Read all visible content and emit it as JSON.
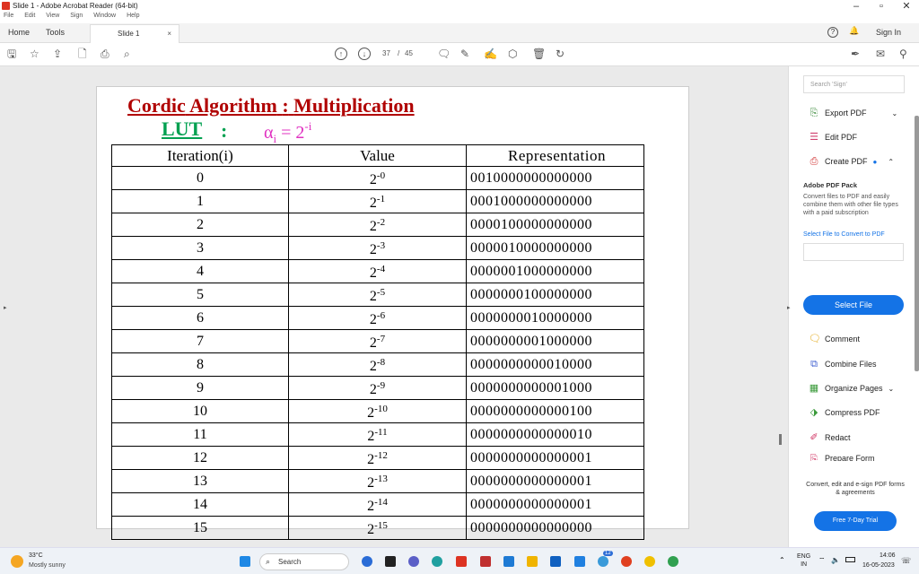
{
  "window": {
    "title": "Slide 1 - Adobe Acrobat Reader (64-bit)",
    "controls": [
      "–",
      "▫",
      "✕"
    ]
  },
  "menu": [
    "File",
    "Edit",
    "View",
    "Sign",
    "Window",
    "Help"
  ],
  "tabs": {
    "home": "Home",
    "tools": "Tools",
    "doc": "Slide 1",
    "close": "×",
    "sign_in": "Sign In"
  },
  "toolbar": {
    "page_current": "37",
    "page_sep": "/",
    "page_total": "45"
  },
  "slide": {
    "title_word1": "Cordic",
    "title_word2": "Algorithm",
    "title_colon": ":",
    "title_word3": "Multiplication",
    "lut": "LUT",
    "lut_colon": ":",
    "alpha": "α",
    "alpha_sub": "i",
    "equals": "= 2",
    "exp": "-i",
    "headers": [
      "Iteration(i)",
      "Value",
      "Representation"
    ],
    "rows": [
      {
        "i": "0",
        "base": "2",
        "exp": "-0",
        "rep": "0010000000000000"
      },
      {
        "i": "1",
        "base": "2",
        "exp": "-1",
        "rep": "0001000000000000"
      },
      {
        "i": "2",
        "base": "2",
        "exp": "-2",
        "rep": "0000100000000000"
      },
      {
        "i": "3",
        "base": "2",
        "exp": "-3",
        "rep": "0000010000000000"
      },
      {
        "i": "4",
        "base": "2",
        "exp": "-4",
        "rep": "0000001000000000"
      },
      {
        "i": "5",
        "base": "2",
        "exp": "-5",
        "rep": "0000000100000000"
      },
      {
        "i": "6",
        "base": "2",
        "exp": "-6",
        "rep": "0000000010000000"
      },
      {
        "i": "7",
        "base": "2",
        "exp": "-7",
        "rep": "0000000001000000"
      },
      {
        "i": "8",
        "base": "2",
        "exp": "-8",
        "rep": "0000000000010000"
      },
      {
        "i": "9",
        "base": "2",
        "exp": "-9",
        "rep": "0000000000001000"
      },
      {
        "i": "10",
        "base": "2",
        "exp": "-10",
        "rep": "0000000000000100"
      },
      {
        "i": "11",
        "base": "2",
        "exp": "-11",
        "rep": "0000000000000010"
      },
      {
        "i": "12",
        "base": "2",
        "exp": "-12",
        "rep": "0000000000000001"
      },
      {
        "i": "13",
        "base": "2",
        "exp": "-13",
        "rep": "0000000000000001"
      },
      {
        "i": "14",
        "base": "2",
        "exp": "-14",
        "rep": "0000000000000001"
      },
      {
        "i": "15",
        "base": "2",
        "exp": "-15",
        "rep": "0000000000000000"
      }
    ]
  },
  "sidepane": {
    "search_placeholder": "Search 'Sign'",
    "export_pdf": "Export PDF",
    "edit_pdf": "Edit PDF",
    "create_pdf": "Create PDF",
    "pack_title": "Adobe PDF Pack",
    "pack_desc": "Convert files to PDF and easily combine them with other file types with a paid subscription",
    "select_link": "Select File to Convert to PDF",
    "select_button": "Select File",
    "comment": "Comment",
    "combine": "Combine Files",
    "organize": "Organize Pages",
    "compress": "Compress PDF",
    "redact": "Redact",
    "prepare": "Prepare Form",
    "promo": "Convert, edit and e-sign PDF forms & agreements",
    "trial": "Free 7-Day Trial"
  },
  "taskbar": {
    "temp": "33°C",
    "weather": "Mostly sunny",
    "search": "Search",
    "lang1": "ENG",
    "lang2": "IN",
    "time": "14:06",
    "date": "16-05-2023",
    "badge": "12"
  },
  "colors": {
    "title_red": "#b00000",
    "lut_green": "#00a050",
    "formula_pink": "#e030c0",
    "accent_blue": "#1473e6"
  }
}
